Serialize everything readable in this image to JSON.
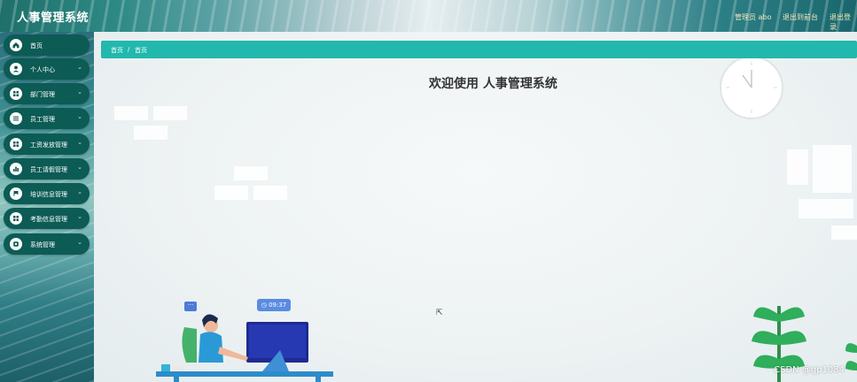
{
  "header": {
    "app_title": "人事管理系统",
    "user_label": "管理员 abo",
    "back_label": "退出到前台",
    "logout_label": "退出登录"
  },
  "sidebar": {
    "items": [
      {
        "label": "首页",
        "icon": "home-icon",
        "has_children": false
      },
      {
        "label": "个人中心",
        "icon": "user-icon",
        "has_children": true
      },
      {
        "label": "部门管理",
        "icon": "grid-icon",
        "has_children": true
      },
      {
        "label": "员工管理",
        "icon": "list-icon",
        "has_children": true
      },
      {
        "label": "工资发放管理",
        "icon": "grid-icon",
        "has_children": true
      },
      {
        "label": "员工请假管理",
        "icon": "bar-chart-icon",
        "has_children": true
      },
      {
        "label": "培训信息管理",
        "icon": "flag-icon",
        "has_children": true
      },
      {
        "label": "考勤信息管理",
        "icon": "grid-icon",
        "has_children": true
      },
      {
        "label": "系统管理",
        "icon": "settings-icon",
        "has_children": true
      }
    ]
  },
  "breadcrumb": {
    "root": "首页",
    "separator": "/",
    "current": "首页"
  },
  "main": {
    "welcome": "欢迎使用 人事管理系统",
    "clock_time": "09:37",
    "chat_bubble": "···"
  },
  "watermark": "CSDN @gp1084",
  "colors": {
    "accent": "#22b8ad",
    "menu_bg": "#0c5b55",
    "header_text": "#f3e8b9"
  }
}
